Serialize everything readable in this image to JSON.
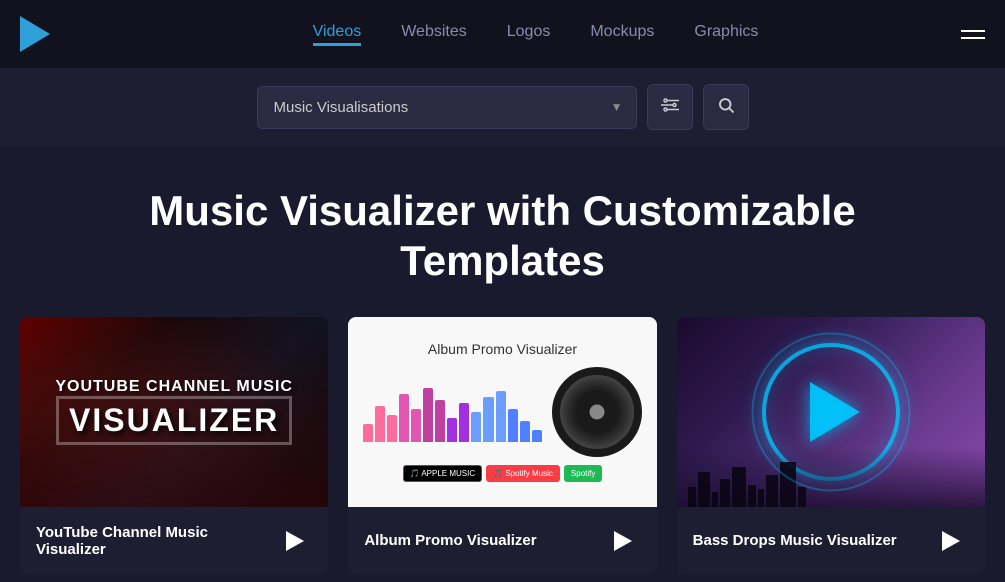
{
  "header": {
    "logo_alt": "Placeit Logo",
    "nav": {
      "items": [
        {
          "label": "Videos",
          "active": true
        },
        {
          "label": "Websites",
          "active": false
        },
        {
          "label": "Logos",
          "active": false
        },
        {
          "label": "Mockups",
          "active": false
        },
        {
          "label": "Graphics",
          "active": false
        }
      ]
    }
  },
  "search": {
    "placeholder": "Music Visualisations",
    "selected_value": "Music Visualisations"
  },
  "hero": {
    "title": "Music Visualizer with Customizable Templates"
  },
  "cards": [
    {
      "title": "YouTube Channel Music Visualizer",
      "subtitle": "YouTube Channel Music",
      "main_text": "VISUALIZER",
      "play_label": "Play"
    },
    {
      "title": "Album Promo Visualizer",
      "album_title": "Album Promo Visualizer",
      "play_label": "Play",
      "badges": [
        "APPLE MUSIC",
        "Spotify Music",
        "Spotify"
      ]
    },
    {
      "title": "Bass Drops Music Visualizer",
      "play_label": "Play"
    }
  ],
  "icons": {
    "filter": "⚙",
    "search": "🔍",
    "hamburger": "≡"
  }
}
